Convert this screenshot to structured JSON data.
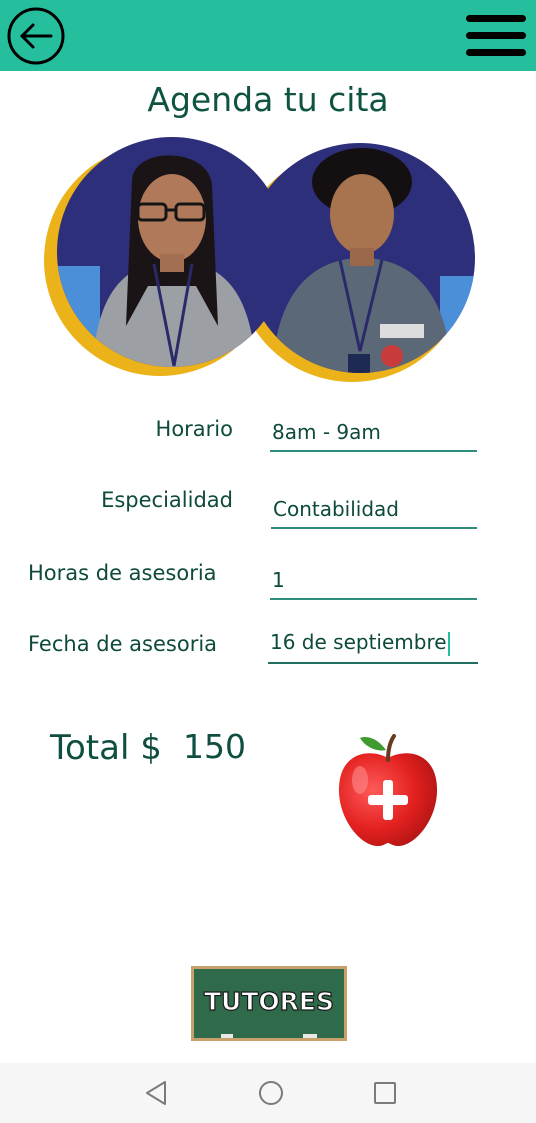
{
  "appbar": {
    "color": "#26bf9e",
    "back_icon": "arrow-left-circle-icon",
    "menu_icon": "hamburger-menu-icon"
  },
  "page": {
    "title": "Agenda tu cita"
  },
  "form": {
    "horario": {
      "label": "Horario",
      "value": "8am - 9am"
    },
    "especialidad": {
      "label": "Especialidad",
      "value": "Contabilidad"
    },
    "horas": {
      "label": "Horas de asesoria",
      "value": "1"
    },
    "fecha": {
      "label": "Fecha de asesoria",
      "value": "16 de septiembre"
    }
  },
  "total": {
    "label": "Total $",
    "value": "150"
  },
  "add_button": {
    "icon": "apple-plus-icon"
  },
  "logo": {
    "text": "TUTORES"
  },
  "system_nav": {
    "back_icon": "triangle-back-icon",
    "home_icon": "circle-home-icon",
    "recents_icon": "square-recents-icon"
  }
}
